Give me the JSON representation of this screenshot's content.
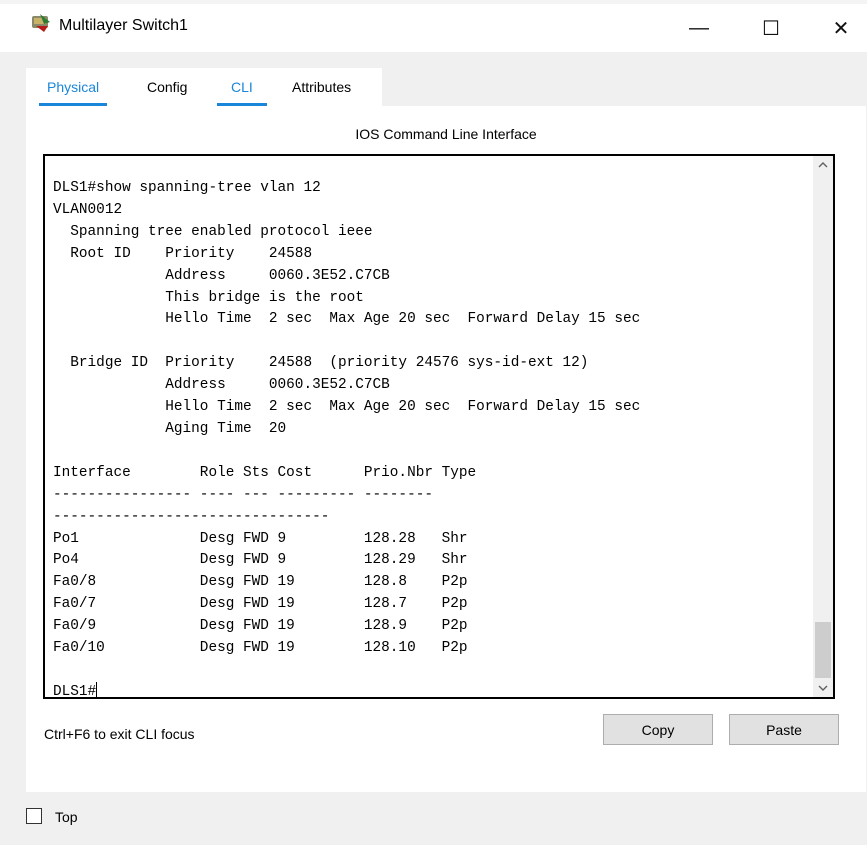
{
  "window": {
    "title": "Multilayer Switch1",
    "controls": {
      "minimize": "—",
      "maximize": "☐",
      "close": "✕"
    },
    "icon": "multilayer-switch-icon"
  },
  "tabs": [
    {
      "label": "Physical",
      "active": true
    },
    {
      "label": "Config",
      "active": false
    },
    {
      "label": "CLI",
      "active": true
    },
    {
      "label": "Attributes",
      "active": false
    }
  ],
  "panel": {
    "title": "IOS Command Line Interface"
  },
  "terminal": {
    "output": "DLS1#show spanning-tree vlan 12\nVLAN0012\n  Spanning tree enabled protocol ieee\n  Root ID    Priority    24588\n             Address     0060.3E52.C7CB\n             This bridge is the root\n             Hello Time  2 sec  Max Age 20 sec  Forward Delay 15 sec\n\n  Bridge ID  Priority    24588  (priority 24576 sys-id-ext 12)\n             Address     0060.3E52.C7CB\n             Hello Time  2 sec  Max Age 20 sec  Forward Delay 15 sec\n             Aging Time  20\n\nInterface        Role Sts Cost      Prio.Nbr Type\n---------------- ---- --- --------- --------\n--------------------------------\nPo1              Desg FWD 9         128.28   Shr\nPo4              Desg FWD 9         128.29   Shr\nFa0/8            Desg FWD 19        128.8    P2p\nFa0/7            Desg FWD 19        128.7    P2p\nFa0/9            Desg FWD 19        128.9    P2p\nFa0/10           Desg FWD 19        128.10   P2p\n\n",
    "prompt": "DLS1#",
    "scrollbar": {
      "up": "^",
      "down": "v"
    }
  },
  "footer": {
    "hint": "Ctrl+F6 to exit CLI focus",
    "copy_label": "Copy",
    "paste_label": "Paste"
  },
  "top_option": {
    "label": "Top",
    "checked": false
  },
  "colors": {
    "accent": "#1a86d9",
    "window_bg": "#f0f0f0",
    "terminal_border": "#000000"
  }
}
